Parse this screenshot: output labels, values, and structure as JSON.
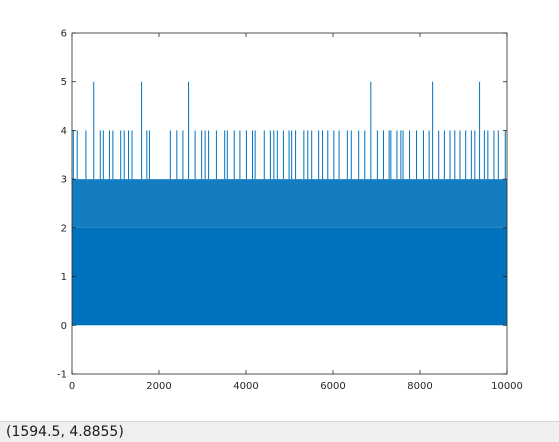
{
  "chart_data": {
    "type": "line",
    "title": "",
    "xlabel": "",
    "ylabel": "",
    "xlim": [
      0,
      10000
    ],
    "ylim": [
      -1,
      6
    ],
    "x_ticks": [
      0,
      2000,
      4000,
      6000,
      8000,
      10000
    ],
    "y_ticks": [
      -1,
      0,
      1,
      2,
      3,
      4,
      5,
      6
    ],
    "x_tick_labels": [
      "0",
      "2000",
      "4000",
      "6000",
      "8000",
      "10000"
    ],
    "y_tick_labels": [
      "-1",
      "0",
      "1",
      "2",
      "3",
      "4",
      "5",
      "6"
    ],
    "grid": false,
    "series": [
      {
        "color": "#0072BD",
        "description_values": {
          "x_range": [
            1,
            10000
          ],
          "y_min": 0,
          "typical_max": 3,
          "spikes_to_5_at_x": [
            500,
            1600,
            2680,
            6870,
            8290,
            9370
          ],
          "spikes_to_4_at_x": [
            30,
            120,
            320,
            650,
            720,
            860,
            940,
            1120,
            1200,
            1300,
            1380,
            1720,
            1780,
            2260,
            2410,
            2550,
            2830,
            2980,
            3060,
            3140,
            3320,
            3510,
            3570,
            3730,
            3860,
            4010,
            4150,
            4210,
            4420,
            4560,
            4640,
            4720,
            4860,
            4990,
            5050,
            5140,
            5330,
            5420,
            5510,
            5670,
            5760,
            5880,
            6020,
            6140,
            6330,
            6420,
            6590,
            6730,
            7020,
            7160,
            7290,
            7330,
            7470,
            7560,
            7610,
            7760,
            7920,
            8080,
            8210,
            8430,
            8560,
            8690,
            8800,
            8920,
            9050,
            9180,
            9260,
            9480,
            9560,
            9700,
            9800,
            9960
          ]
        }
      }
    ]
  },
  "status": {
    "coordinates": "(1594.5, 4.8855)"
  }
}
